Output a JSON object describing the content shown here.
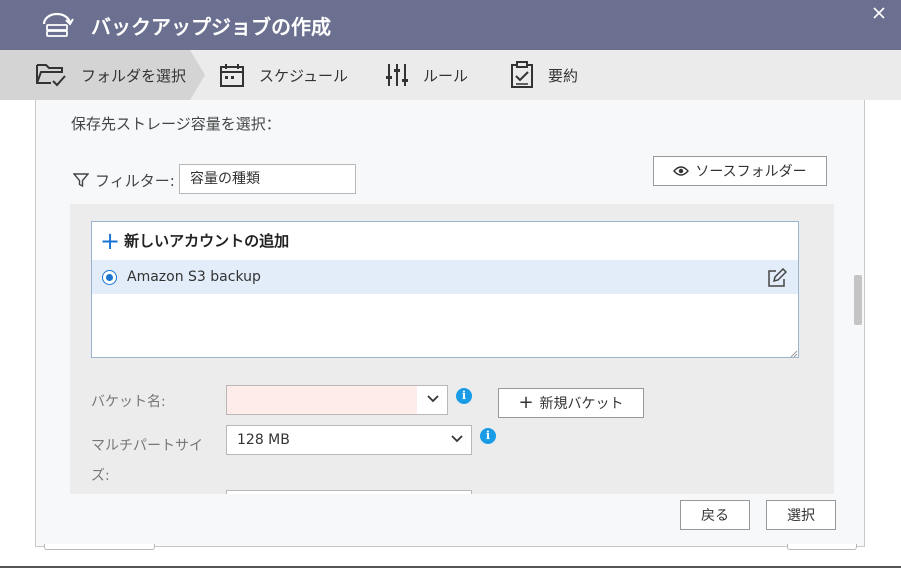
{
  "window": {
    "title": "バックアップジョブの作成"
  },
  "steps": [
    {
      "label": "フォルダを選択",
      "icon": "folder-check-icon",
      "active": true
    },
    {
      "label": "スケジュール",
      "icon": "calendar-icon"
    },
    {
      "label": "ルール",
      "icon": "sliders-icon"
    },
    {
      "label": "要約",
      "icon": "clipboard-icon"
    }
  ],
  "main": {
    "section_label": "保存先ストレージ容量を選択：",
    "filter": {
      "label": "フィルター:",
      "value": "容量の種類"
    },
    "source_folder_button": "ソースフォルダー",
    "account_list": {
      "add_account": "新しいアカウントの追加",
      "items": [
        {
          "label": "Amazon S3 backup",
          "selected": true
        }
      ]
    },
    "bucket": {
      "label": "バケット名:",
      "value": "",
      "new_bucket_button": "新規バケット"
    },
    "multipart": {
      "label": "マルチパートサイズ:",
      "value": "128 MB"
    }
  },
  "footer": {
    "back_button": "戻る",
    "select_button": "選択"
  },
  "colors": {
    "titlebar": "#6b7090",
    "accent": "#1a75d2",
    "info": "#1a9be6",
    "selected_row": "#e3edf9",
    "error_field": "#fdecea"
  }
}
